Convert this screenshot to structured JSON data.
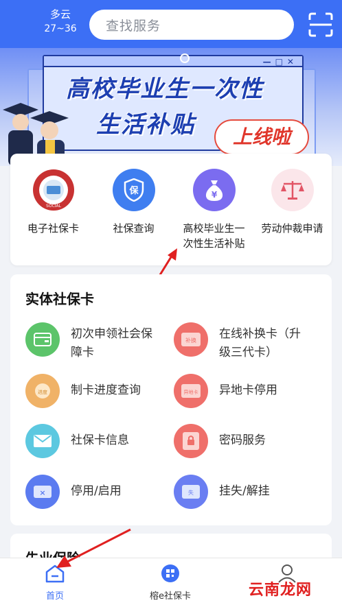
{
  "header": {
    "weather_condition": "多云",
    "weather_temp": "27~36",
    "search_placeholder": "查找服务"
  },
  "banner": {
    "title_line1": "高校毕业生一次性",
    "title_line2": "生活补贴",
    "badge": "上线啦"
  },
  "quick_services": [
    {
      "label": "电子社保卡",
      "icon": "social-security-card-logo"
    },
    {
      "label": "社保查询",
      "icon": "shield-bao-icon"
    },
    {
      "label": "高校毕业生一次性生活补贴",
      "label_line1": "高校毕业生一",
      "label_line2": "次性生活补贴",
      "icon": "money-bag-icon"
    },
    {
      "label": "劳动仲裁申请",
      "icon": "scales-icon"
    }
  ],
  "card_section": {
    "title": "实体社保卡",
    "items": [
      {
        "label_line1": "初次申领社会保",
        "label_line2": "障卡",
        "icon": "card-wallet-icon",
        "color": "#5cc46a"
      },
      {
        "label_line1": "在线补换卡（升",
        "label_line2": "级三代卡）",
        "icon": "replace-card-icon",
        "color": "#ef6f6a"
      },
      {
        "label": "制卡进度查询",
        "icon": "progress-query-icon",
        "color": "#f0b267"
      },
      {
        "label": "异地卡停用",
        "icon": "remote-card-disable-icon",
        "color": "#ef6f6a"
      },
      {
        "label": "社保卡信息",
        "icon": "mail-icon",
        "color": "#5cc8e0"
      },
      {
        "label": "密码服务",
        "icon": "password-icon",
        "color": "#ef6f6a"
      },
      {
        "label": "停用/启用",
        "icon": "card-disable-icon",
        "color": "#5b7bf0"
      },
      {
        "label": "挂失/解挂",
        "icon": "report-loss-icon",
        "color": "#6a7ef2"
      }
    ]
  },
  "next_section": {
    "title": "失业保险"
  },
  "bottom_nav": [
    {
      "label": "首页",
      "icon": "home-icon",
      "active": true
    },
    {
      "label": "榕e社保卡",
      "icon": "qr-card-icon",
      "active": false
    },
    {
      "label": "",
      "icon": "user-icon",
      "active": false
    }
  ],
  "watermark": "云南龙网",
  "colors": {
    "primary": "#3c6ff5",
    "arrow": "#e02020"
  }
}
